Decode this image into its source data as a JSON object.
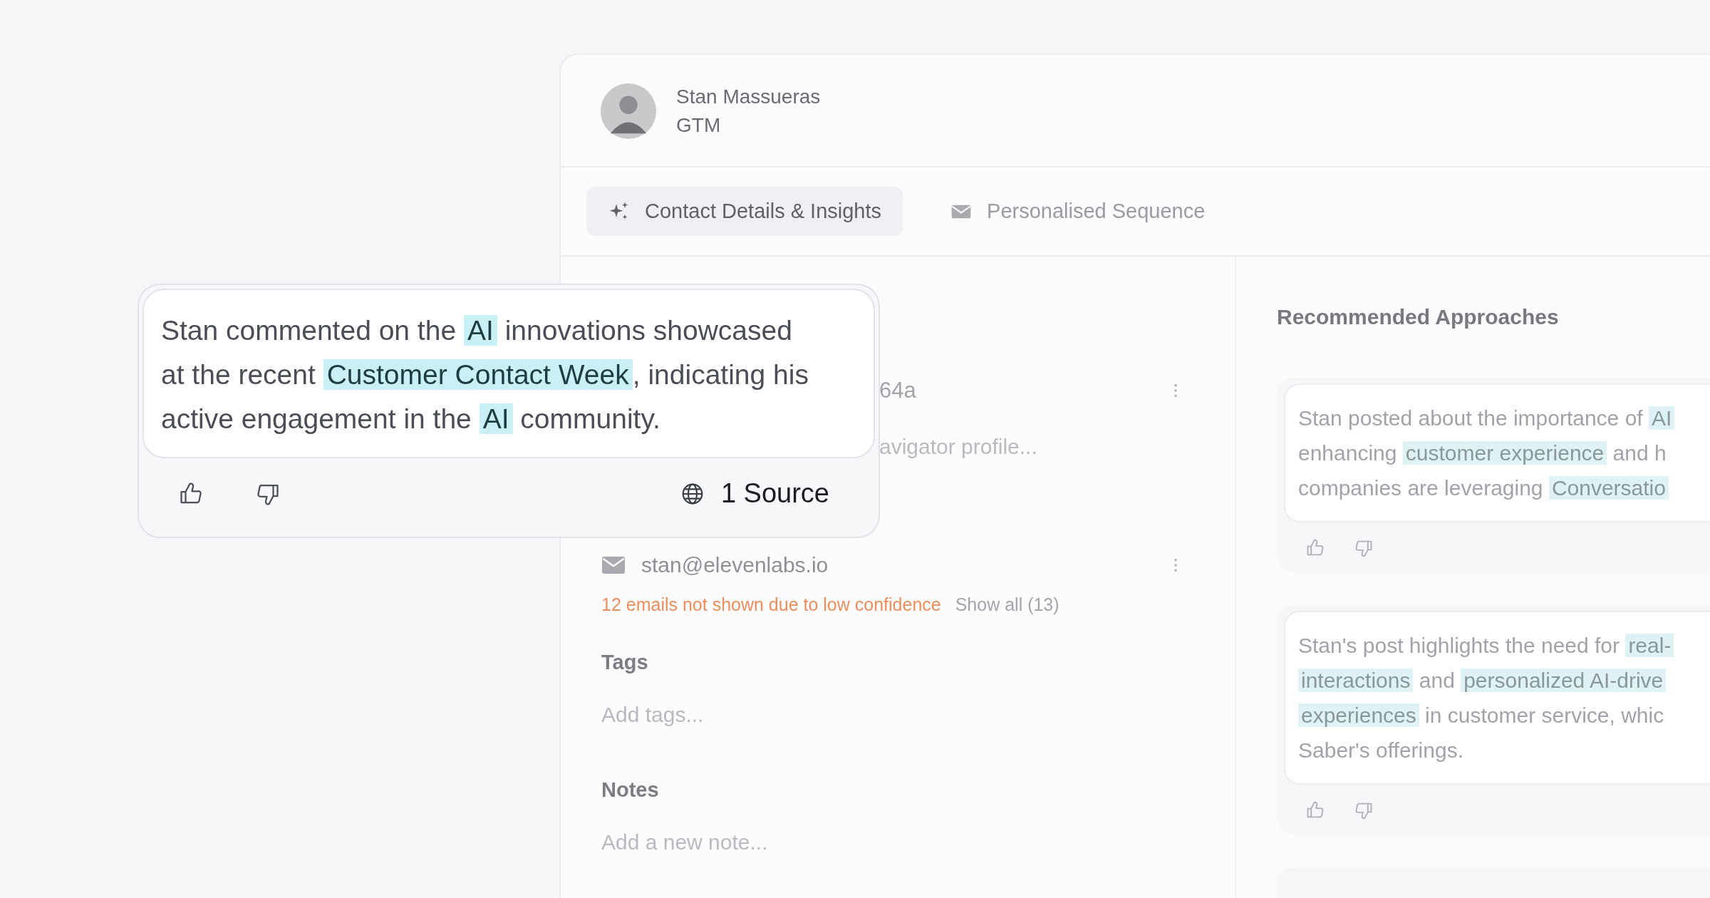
{
  "profile": {
    "name": "Stan Massueras",
    "role": "GTM"
  },
  "tabs": [
    {
      "label": "Contact Details & Insights",
      "selected": true
    },
    {
      "label": "Personalised Sequence",
      "selected": false
    }
  ],
  "contact": {
    "linkedin_id": "64a",
    "linkedin_field": {
      "placeholder": "avigator profile..."
    },
    "email": "stan@elevenlabs.io",
    "email_warning": "12 emails not shown due to low confidence",
    "show_all": "Show all (13)",
    "tags": {
      "label": "Tags",
      "placeholder": "Add tags..."
    },
    "notes": {
      "label": "Notes",
      "placeholder": "Add a new note..."
    }
  },
  "recommended": {
    "title": "Recommended Approaches",
    "cards": [
      {
        "kind": "insight",
        "lines": [
          [
            {
              "t": "Stan posted about the importance of ",
              "hl": false
            },
            {
              "t": "AI",
              "hl": true
            }
          ],
          [
            {
              "t": "enhancing ",
              "hl": false
            },
            {
              "t": "customer experience",
              "hl": true
            },
            {
              "t": " and h",
              "hl": false
            }
          ],
          [
            {
              "t": "companies are leveraging ",
              "hl": false
            },
            {
              "t": "Conversatio",
              "hl": true
            }
          ]
        ]
      },
      {
        "kind": "insight",
        "lines": [
          [
            {
              "t": "Stan's post highlights the need for ",
              "hl": false
            },
            {
              "t": "real-",
              "hl": true
            }
          ],
          [
            {
              "t": "interactions",
              "hl": true
            },
            {
              "t": " and ",
              "hl": false
            },
            {
              "t": "personalized AI-drive",
              "hl": true
            }
          ],
          [
            {
              "t": "experiences",
              "hl": true
            },
            {
              "t": " in customer service, whic",
              "hl": false
            }
          ],
          [
            {
              "t": "Saber's offerings.",
              "hl": false
            }
          ]
        ]
      },
      {
        "kind": "cut"
      }
    ]
  },
  "popup": {
    "lines": [
      [
        {
          "t": "Stan commented on the ",
          "hl": false
        },
        {
          "t": "AI",
          "hl": true
        },
        {
          "t": " innovations showcased",
          "hl": false
        }
      ],
      [
        {
          "t": "at the recent ",
          "hl": false
        },
        {
          "t": "Customer Contact Week",
          "hl": true
        },
        {
          "t": ", indicating his",
          "hl": false
        }
      ],
      [
        {
          "t": "active engagement in the ",
          "hl": false
        },
        {
          "t": "AI",
          "hl": true
        },
        {
          "t": " community.",
          "hl": false
        }
      ]
    ],
    "source": "1 Source"
  }
}
